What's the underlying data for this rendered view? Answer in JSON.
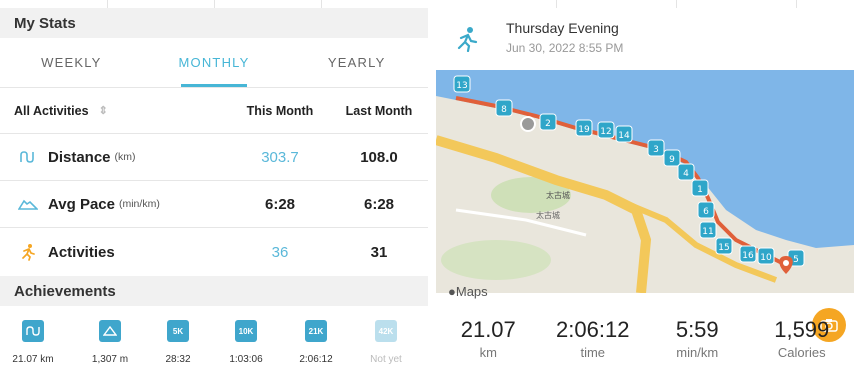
{
  "stats": {
    "title": "My Stats",
    "tabs": [
      {
        "label": "WEEKLY"
      },
      {
        "label": "MONTHLY"
      },
      {
        "label": "YEARLY"
      }
    ],
    "active_tab": "MONTHLY",
    "filter_label": "All Activities",
    "filter_icon": "up-down-icon",
    "col_this_month": "This Month",
    "col_last_month": "Last Month",
    "rows": [
      {
        "label": "Distance",
        "unit": "(km)",
        "icon": "distance-icon",
        "this_month": "303.7",
        "last_month": "108.0"
      },
      {
        "label": "Avg Pace",
        "unit": "(min/km)",
        "icon": "shoe-icon",
        "this_month": "6:28",
        "last_month": "6:28"
      },
      {
        "label": "Activities",
        "unit": "",
        "icon": "runner-icon",
        "this_month": "36",
        "last_month": "31"
      }
    ]
  },
  "achievements": {
    "title": "Achievements",
    "badges": [
      {
        "icon": "distance-badge-icon",
        "value": "21.07 km"
      },
      {
        "icon": "elevation-badge-icon",
        "value": "1,307 m"
      },
      {
        "icon": "5k-badge-icon",
        "value": "28:32",
        "badge_text": "5K"
      },
      {
        "icon": "10k-badge-icon",
        "value": "1:03:06",
        "badge_text": "10K"
      },
      {
        "icon": "21k-badge-icon",
        "value": "2:06:12",
        "badge_text": "21K"
      },
      {
        "icon": "locked-badge-icon",
        "value": "Not yet",
        "badge_text": "42K"
      }
    ]
  },
  "activity": {
    "title": "Thursday Evening",
    "datetime": "Jun 30, 2022 8:55 PM",
    "maps_label": "Maps",
    "map_places": [
      "太古城",
      "太古城"
    ],
    "km_markers": [
      "13",
      "8",
      "2",
      "19",
      "12",
      "14",
      "3",
      "9",
      "4",
      "1",
      "6",
      "11",
      "15",
      "16",
      "10",
      "5"
    ],
    "summary": [
      {
        "value": "21.07",
        "label": "km"
      },
      {
        "value": "2:06:12",
        "label": "time"
      },
      {
        "value": "5:59",
        "label": "min/km"
      },
      {
        "value": "1,599",
        "label": "Calories"
      }
    ]
  },
  "colors": {
    "accent": "#47b6d6",
    "route": "#e0603a",
    "water": "#7fb6e8",
    "camera": "#f5a623"
  }
}
